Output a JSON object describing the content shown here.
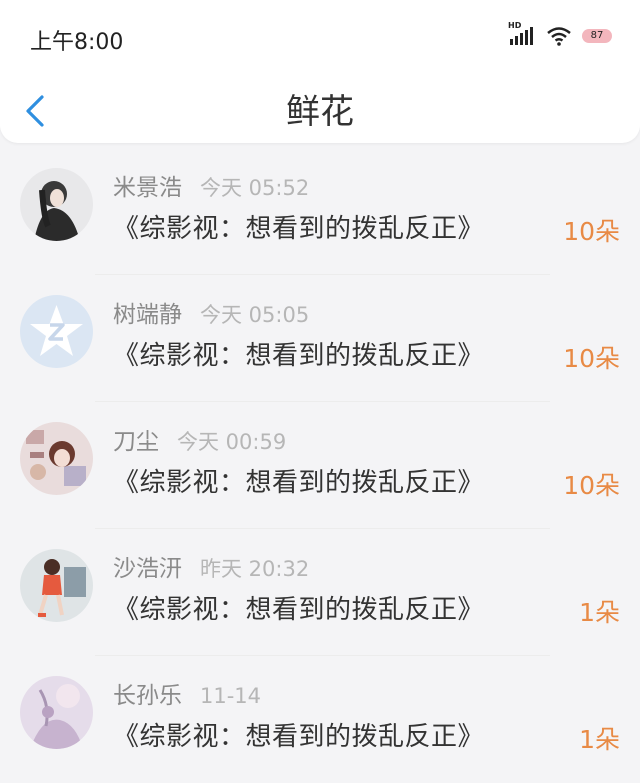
{
  "status": {
    "time": "上午8:00",
    "network": "HD",
    "battery": "87"
  },
  "header": {
    "title": "鲜花"
  },
  "items": [
    {
      "name": "米景浩",
      "time": "今天 05:52",
      "message": "《综影视：想看到的拨乱反正》",
      "count": "10朵"
    },
    {
      "name": "树端静",
      "time": "今天 05:05",
      "message": "《综影视：想看到的拨乱反正》",
      "count": "10朵"
    },
    {
      "name": "刀尘",
      "time": "今天 00:59",
      "message": "《综影视：想看到的拨乱反正》",
      "count": "10朵"
    },
    {
      "name": "沙浩汧",
      "time": "昨天 20:32",
      "message": "《综影视：想看到的拨乱反正》",
      "count": "1朵"
    },
    {
      "name": "长孙乐",
      "time": "11-14",
      "message": "《综影视：想看到的拨乱反正》",
      "count": "1朵"
    }
  ],
  "colors": {
    "accent": "#2f8fe0",
    "count": "#e88a45",
    "battery": "#f3b6bd"
  }
}
